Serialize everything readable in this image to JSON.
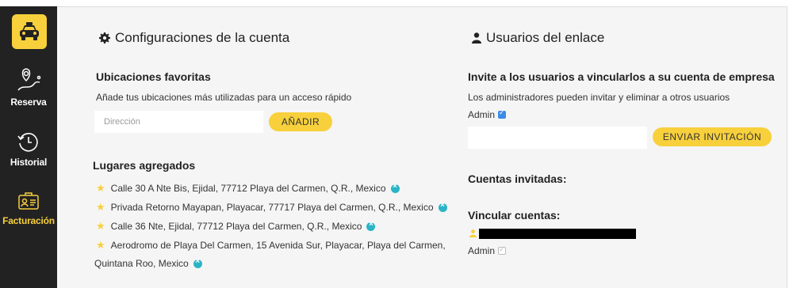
{
  "sidebar": {
    "logo_icon": "taxi-icon",
    "items": [
      {
        "label": "Reserva",
        "icon": "route-pin-icon",
        "active": false
      },
      {
        "label": "Historial",
        "icon": "history-clock-icon",
        "active": false
      },
      {
        "label": "Facturación",
        "icon": "invoice-card-icon",
        "active": true
      }
    ],
    "accent": "#f7d03c",
    "background": "#222222"
  },
  "account_settings": {
    "title": "Configuraciones de la cuenta",
    "title_icon": "gear-icon",
    "favorites_heading": "Ubicaciones favoritas",
    "favorites_description": "Añade tus ubicaciones más utilizadas para un acceso rápido",
    "address_placeholder": "Dirección",
    "add_button": "AÑADIR",
    "added_heading": "Lugares agregados",
    "places": [
      {
        "line1": "Calle 30 A Nte Bis, Ejidal, 77712 Playa del Carmen, Q.R., Mexico",
        "line2": ""
      },
      {
        "line1": "Privada Retorno Mayapan, Playacar, 77717 Playa del Carmen, Q.R., Mexico",
        "line2": ""
      },
      {
        "line1": "Calle 36 Nte, Ejidal, 77712 Playa del Carmen, Q.R., Mexico",
        "line2": ""
      },
      {
        "line1": "Aerodromo de Playa Del Carmen, 15 Avenida Sur, Playacar, Playa del Carmen,",
        "line2": "Quintana Roo, Mexico"
      }
    ]
  },
  "linked_users": {
    "title": "Usuarios del enlace",
    "title_icon": "user-icon",
    "invite_heading": "Invite a los usuarios a vincularlos a su cuenta de empresa",
    "invite_description": "Los administradores pueden invitar y eliminar a otros usuarios",
    "admin_label": "Admin",
    "admin_checked": true,
    "invite_input_value": "",
    "invite_button": "ENVIAR INVITACIÓN",
    "invited_heading": "Cuentas invitadas:",
    "link_heading": "Vincular cuentas:",
    "linked_admin_label": "Admin",
    "linked_admin_checked": false
  },
  "colors": {
    "button": "#f7d03c",
    "remove_icon": "#2ab4c5",
    "checkbox": "#3b8ce6"
  }
}
